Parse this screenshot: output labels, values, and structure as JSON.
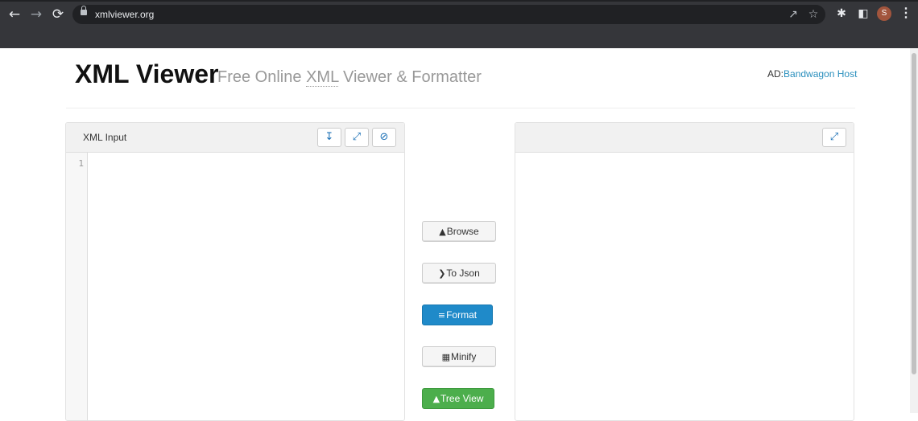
{
  "browser": {
    "url": "xmlviewer.org",
    "avatar_letter": "S",
    "icons": [
      "back-icon",
      "forward-icon",
      "reload-icon",
      "lock-icon",
      "share-icon",
      "bookmark-star-icon",
      "extensions-icon",
      "side-panel-icon",
      "menu-icon"
    ]
  },
  "header": {
    "title": "XML Viewer",
    "subtitle_pre": "Free Online ",
    "subtitle_abbr": "XML",
    "subtitle_post": " Viewer & Formatter",
    "ad_prefix": "AD:",
    "ad_link": "Bandwagon Host"
  },
  "input_panel": {
    "title": "XML Input",
    "line_number": "1"
  },
  "actions": {
    "browse": "Browse",
    "to_json": "To Json",
    "format": "Format",
    "minify": "Minify",
    "tree_view": "Tree View"
  },
  "colors": {
    "format_button": "#1f8ac9",
    "tree_view_button": "#4cae4c",
    "ad_link": "#2a8fbd"
  }
}
